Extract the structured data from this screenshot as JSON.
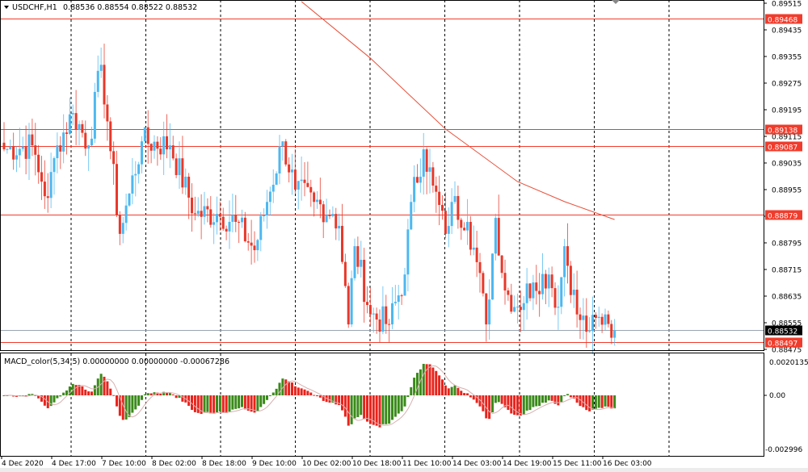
{
  "header": {
    "symbol_label": "USDCHF,H1",
    "ohlc": "0.88536 0.88554 0.88522 0.88532"
  },
  "macd": {
    "label": "MACD_color(5,34,5) 0.00000000 0.00000000 -0.00067286",
    "top_label": "0.0020135",
    "zero_label": "0.00",
    "bottom_label": "-0.002996",
    "range": [
      -0.002996,
      0.0020135
    ],
    "up_color": "#3a8a1a",
    "down_color": "#e8231c"
  },
  "price_axis": {
    "ticks": [
      "0.89515",
      "0.89435",
      "0.89355",
      "0.89275",
      "0.89195",
      "0.89115",
      "0.89035",
      "0.88955",
      "0.88875",
      "0.88795",
      "0.88715",
      "0.88635",
      "0.88555",
      "0.88475"
    ],
    "range": [
      0.88475,
      0.89515
    ]
  },
  "levels": [
    {
      "price": 0.89468,
      "label": "0.89468"
    },
    {
      "price": 0.89138,
      "label": "0.89138"
    },
    {
      "price": 0.89087,
      "label": "0.89087"
    },
    {
      "price": 0.88879,
      "label": "0.88879"
    },
    {
      "price": 0.88497,
      "label": "0.88497"
    }
  ],
  "current_price": {
    "price": 0.88532,
    "label": "0.88532"
  },
  "time_axis": [
    "4 Dec 2020",
    "4 Dec 17:00",
    "7 Dec 10:00",
    "8 Dec 02:00",
    "8 Dec 18:00",
    "9 Dec 10:00",
    "10 Dec 02:00",
    "10 Dec 18:00",
    "11 Dec 10:00",
    "14 Dec 03:00",
    "14 Dec 19:00",
    "15 Dec 11:00",
    "16 Dec 03:00"
  ],
  "colors": {
    "bull": "#4db8f0",
    "bear": "#e8382a",
    "level": "#f03c2c",
    "ma": "#e8503a",
    "current": "#9aa4b0"
  },
  "price_path": [
    [
      0,
      0.89076
    ],
    [
      9,
      0.89088
    ],
    [
      12,
      0.88979
    ],
    [
      14,
      0.8893
    ],
    [
      17,
      0.89088
    ],
    [
      22,
      0.89185
    ],
    [
      27,
      0.89088
    ],
    [
      31,
      0.8933
    ],
    [
      33,
      0.8916
    ],
    [
      37,
      0.88822
    ],
    [
      40,
      0.88943
    ],
    [
      44,
      0.891
    ],
    [
      53,
      0.89088
    ],
    [
      61,
      0.88882
    ],
    [
      68,
      0.88882
    ],
    [
      74,
      0.88858
    ],
    [
      80,
      0.88773
    ],
    [
      84,
      0.88918
    ],
    [
      89,
      0.891
    ],
    [
      93,
      0.88955
    ],
    [
      99,
      0.88918
    ],
    [
      105,
      0.88882
    ],
    [
      107,
      0.88846
    ],
    [
      110,
      0.8855
    ],
    [
      112,
      0.88785
    ],
    [
      117,
      0.8858
    ],
    [
      123,
      0.8855
    ],
    [
      128,
      0.887
    ],
    [
      130,
      0.88918
    ],
    [
      134,
      0.89076
    ],
    [
      137,
      0.88967
    ],
    [
      141,
      0.88822
    ],
    [
      143,
      0.88918
    ],
    [
      148,
      0.88858
    ],
    [
      151,
      0.88737
    ],
    [
      154,
      0.8855
    ],
    [
      157,
      0.8887
    ],
    [
      160,
      0.88652
    ],
    [
      164,
      0.88603
    ],
    [
      169,
      0.88676
    ],
    [
      174,
      0.887
    ],
    [
      177,
      0.88603
    ],
    [
      179,
      0.88785
    ],
    [
      183,
      0.8858
    ],
    [
      187,
      0.8853
    ],
    [
      192,
      0.8858
    ],
    [
      195,
      0.88532
    ]
  ],
  "ma_path": [
    [
      95,
      0.8952
    ],
    [
      117,
      0.8935
    ],
    [
      141,
      0.89137
    ],
    [
      164,
      0.88979
    ],
    [
      179,
      0.88919
    ],
    [
      195,
      0.88865
    ]
  ]
}
